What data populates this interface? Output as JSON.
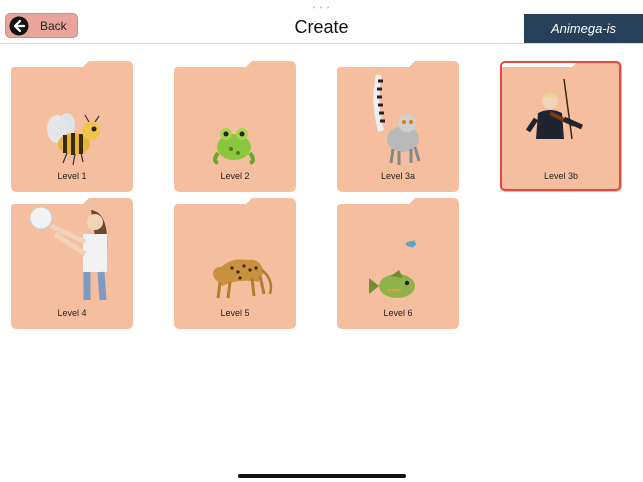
{
  "header": {
    "back_label": "Back",
    "title": "Create",
    "brand": "Animega-is"
  },
  "colors": {
    "folder_fill": "#f5bf9f",
    "selected_border": "#e8453c",
    "brand_bg": "#27405a",
    "back_bg": "#e9a59b"
  },
  "levels": [
    {
      "label": "Level 1",
      "icon": "bee-icon"
    },
    {
      "label": "Level 2",
      "icon": "frog-icon"
    },
    {
      "label": "Level 3a",
      "icon": "lemur-icon"
    },
    {
      "label": "Level 3b",
      "icon": "violinist-icon",
      "selected": true
    },
    {
      "label": "Level 4",
      "icon": "girl-with-ball-icon"
    },
    {
      "label": "Level 5",
      "icon": "leopard-icon"
    },
    {
      "label": "Level 6",
      "icon": "fish-icon"
    }
  ]
}
